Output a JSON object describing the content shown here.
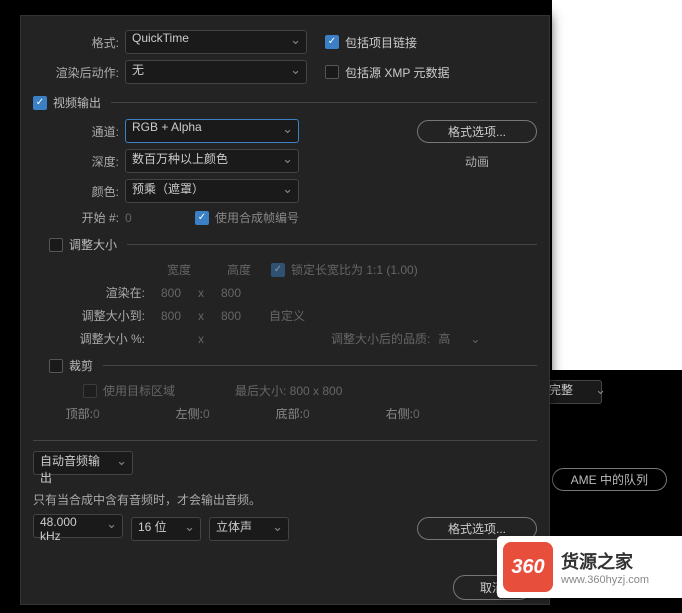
{
  "top": {
    "format_label": "格式:",
    "format_value": "QuickTime",
    "include_link_label": "包括项目链接",
    "render_action_label": "渲染后动作:",
    "render_action_value": "无",
    "include_xmp_label": "包括源 XMP 元数据"
  },
  "video": {
    "section_label": "视频输出",
    "channel_label": "通道:",
    "channel_value": "RGB + Alpha",
    "depth_label": "深度:",
    "depth_value": "数百万种以上颜色",
    "color_label": "颜色:",
    "color_value": "预乘（遮罩）",
    "start_label": "开始 #:",
    "start_value": "0",
    "use_comp_label": "使用合成帧编号",
    "format_opts": "格式选项...",
    "anim_label": "动画"
  },
  "resize": {
    "section_label": "调整大小",
    "width_label": "宽度",
    "height_label": "高度",
    "lock_label": "锁定长宽比为 1:1 (1.00)",
    "render_at_label": "渲染在:",
    "render_w": "800",
    "render_h": "800",
    "resize_to_label": "调整大小到:",
    "resize_w": "800",
    "resize_h": "800",
    "custom_label": "自定义",
    "resize_pct_label": "调整大小 %:",
    "quality_label": "调整大小后的品质:",
    "quality_value": "高",
    "x": "x"
  },
  "crop": {
    "section_label": "裁剪",
    "use_target_label": "使用目标区域",
    "final_size_label": "最后大小: 800 x 800",
    "top_label": "顶部:",
    "top_v": "0",
    "left_label": "左侧:",
    "left_v": "0",
    "bottom_label": "底部:",
    "bottom_v": "0",
    "right_label": "右侧:",
    "right_v": "0"
  },
  "audio": {
    "mode": "自动音频输出",
    "note": "只有当合成中含有音频时，才会输出音频。",
    "rate": "48.000 kHz",
    "bit": "16 位",
    "channels": "立体声",
    "format_opts": "格式选项..."
  },
  "footer": {
    "cancel": "取消"
  },
  "bg": {
    "full": "完整",
    "ame": "AME 中的队列"
  },
  "watermark": {
    "badge": "360",
    "title": "货源之家",
    "url": "www.360hyzj.com"
  }
}
